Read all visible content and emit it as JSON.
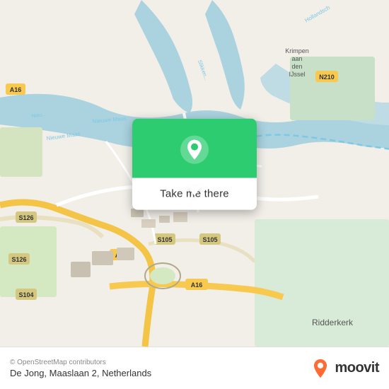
{
  "map": {
    "copyright": "© OpenStreetMap contributors",
    "background_color": "#e8e0d8",
    "water_color": "#aad3df",
    "road_color": "#ffffff",
    "highway_color": "#f8c94f",
    "green_area_color": "#c8e6c9"
  },
  "popup": {
    "button_label": "Take me there",
    "pin_color": "#2ecc71"
  },
  "footer": {
    "copyright": "© OpenStreetMap contributors",
    "address": "De Jong, Maaslaan 2, Netherlands"
  },
  "moovit": {
    "label": "moovit"
  }
}
